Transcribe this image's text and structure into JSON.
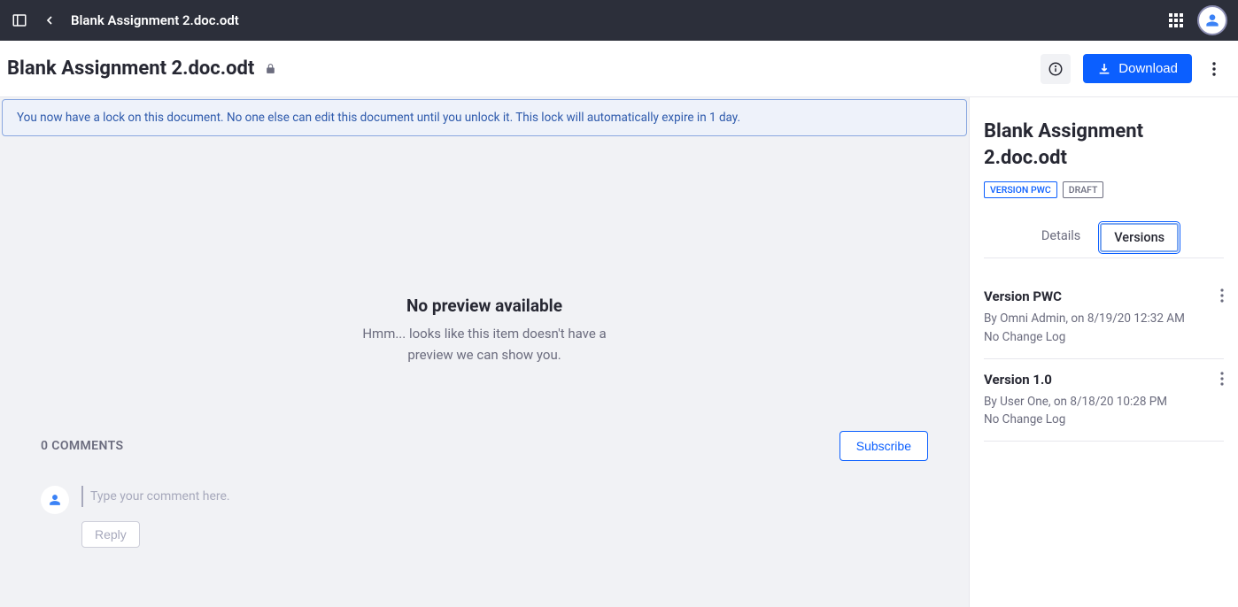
{
  "nav": {
    "title": "Blank Assignment 2.doc.odt"
  },
  "header": {
    "title": "Blank Assignment 2.doc.odt",
    "download_label": "Download"
  },
  "alert": {
    "text": "You now have a lock on this document. No one else can edit this document until you unlock it. This lock will automatically expire in 1 day."
  },
  "preview": {
    "title": "No preview available",
    "subtitle_line1": "Hmm... looks like this item doesn't have a",
    "subtitle_line2": "preview we can show you."
  },
  "comments": {
    "count_label": "0 COMMENTS",
    "subscribe_label": "Subscribe",
    "placeholder": "Type your comment here.",
    "reply_label": "Reply"
  },
  "sidebar": {
    "title": "Blank Assignment 2.doc.odt",
    "badge_version": "VERSION PWC",
    "badge_draft": "DRAFT",
    "tabs": {
      "details": "Details",
      "versions": "Versions"
    },
    "versions": [
      {
        "title": "Version PWC",
        "by": "By Omni Admin, on 8/19/20 12:32 AM",
        "changelog": "No Change Log"
      },
      {
        "title": "Version 1.0",
        "by": "By User One, on 8/18/20 10:28 PM",
        "changelog": "No Change Log"
      }
    ]
  }
}
